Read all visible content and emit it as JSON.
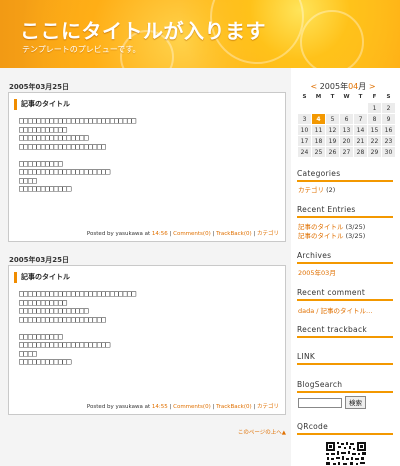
{
  "header": {
    "title": "ここにタイトルが入ります",
    "subtitle": "テンプレートのプレビューです。"
  },
  "entries": [
    {
      "date": "2005年03月25日",
      "title": "記事のタイトル",
      "body": "□□□□□□□□□□□□□□□□□□□□□□□□□□□\n□□□□□□□□□□□\n□□□□□□□□□□□□□□□□\n□□□□□□□□□□□□□□□□□□□□\n\n□□□□□□□□□□\n□□□□□□□□□□□□□□□□□□□□□\n□□□□\n□□□□□□□□□□□□",
      "posted_by": "Posted by yasukawa at",
      "time": "14:56",
      "comments": "Comments(0)",
      "trackback": "TrackBack(0)",
      "category": "カテゴリ"
    },
    {
      "date": "2005年03月25日",
      "title": "記事のタイトル",
      "body": "□□□□□□□□□□□□□□□□□□□□□□□□□□□\n□□□□□□□□□□□\n□□□□□□□□□□□□□□□□\n□□□□□□□□□□□□□□□□□□□□\n\n□□□□□□□□□□\n□□□□□□□□□□□□□□□□□□□□□\n□□□□\n□□□□□□□□□□□□",
      "posted_by": "Posted by yasukawa at",
      "time": "14:55",
      "comments": "Comments(0)",
      "trackback": "TrackBack(0)",
      "category": "カテゴリ"
    }
  ],
  "to_top": "このページの上へ▲",
  "calendar": {
    "prev": "<",
    "year": "2005年",
    "month": "04",
    "month_suffix": "月",
    "next": ">",
    "weekdays": [
      "S",
      "M",
      "T",
      "W",
      "T",
      "F",
      "S"
    ],
    "weeks": [
      [
        "",
        "",
        "",
        "",
        "",
        "1",
        "2"
      ],
      [
        "3",
        "4",
        "5",
        "6",
        "7",
        "8",
        "9"
      ],
      [
        "10",
        "11",
        "12",
        "13",
        "14",
        "15",
        "16"
      ],
      [
        "17",
        "18",
        "19",
        "20",
        "21",
        "22",
        "23"
      ],
      [
        "24",
        "25",
        "26",
        "27",
        "28",
        "29",
        "30"
      ]
    ],
    "today": "4"
  },
  "sidebar": {
    "categories_title": "Categories",
    "category_link": "カテゴリ",
    "category_count": "(2)",
    "recent_entries_title": "Recent Entries",
    "recent_entries": [
      {
        "title": "記事のタイトル",
        "date": "(3/25)"
      },
      {
        "title": "記事のタイトル",
        "date": "(3/25)"
      }
    ],
    "archives_title": "Archives",
    "archive_link": "2005年03月",
    "recent_comment_title": "Recent comment",
    "recent_comment": "dada / 記事のタイトル…",
    "recent_trackback_title": "Recent trackback",
    "link_title": "LINK",
    "blogsearch_title": "BlogSearch",
    "search_button": "検索",
    "qrcode_title": "QRcode"
  },
  "colors": {
    "accent": "#f39800",
    "link": "#e07000"
  }
}
